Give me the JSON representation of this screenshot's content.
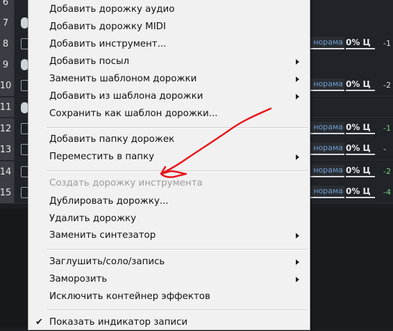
{
  "tracks": [
    {
      "num": "6",
      "pan": "",
      "vol": "",
      "meter": ""
    },
    {
      "num": "7",
      "pan": "",
      "vol": "",
      "meter": ""
    },
    {
      "num": "8",
      "pan": "норама",
      "vol": "0% Ц",
      "meter": "-1"
    },
    {
      "num": "9",
      "pan": "",
      "vol": "",
      "meter": ""
    },
    {
      "num": "10",
      "pan": "норама",
      "vol": "0% Ц",
      "meter": "-2"
    },
    {
      "num": "11",
      "pan": "",
      "vol": "",
      "meter": ""
    },
    {
      "num": "12",
      "pan": "норама",
      "vol": "0% Ц",
      "meter": "-1"
    },
    {
      "num": "13",
      "pan": "норама",
      "vol": "0% Ц",
      "meter": "-"
    },
    {
      "num": "14",
      "pan": "норама",
      "vol": "0% Ц",
      "meter": "-2"
    },
    {
      "num": "15",
      "pan": "норама",
      "vol": "0% Ц",
      "meter": "-4"
    }
  ],
  "menu": {
    "items": [
      {
        "label": "Добавить дорожку аудио",
        "submenu": false,
        "disabled": false
      },
      {
        "label": "Добавить дорожку MIDI",
        "submenu": false,
        "disabled": false
      },
      {
        "label": "Добавить инструмент...",
        "submenu": false,
        "disabled": false
      },
      {
        "label": "Добавить посыл",
        "submenu": true,
        "disabled": false
      },
      {
        "label": "Заменить шаблоном дорожки",
        "submenu": true,
        "disabled": false
      },
      {
        "label": "Добавить из шаблона дорожки",
        "submenu": true,
        "disabled": false
      },
      {
        "label": "Сохранить как шаблон дорожки...",
        "submenu": false,
        "disabled": false
      },
      {
        "label": "Добавить папку дорожек",
        "submenu": false,
        "disabled": false
      },
      {
        "label": "Переместить в папку",
        "submenu": true,
        "disabled": false
      },
      {
        "label": "Создать дорожку инструмента",
        "submenu": false,
        "disabled": true
      },
      {
        "label": "Дублировать дорожку...",
        "submenu": false,
        "disabled": false
      },
      {
        "label": "Удалить дорожку",
        "submenu": false,
        "disabled": false
      },
      {
        "label": "Заменить синтезатор",
        "submenu": true,
        "disabled": false
      },
      {
        "label": "Заглушить/соло/запись",
        "submenu": true,
        "disabled": false
      },
      {
        "label": "Заморозить",
        "submenu": true,
        "disabled": false
      },
      {
        "label": "Исключить контейнер эффектов",
        "submenu": false,
        "disabled": false
      },
      {
        "label": "Показать индикатор записи",
        "submenu": false,
        "disabled": false,
        "checked": true
      }
    ],
    "check_glyph": "✔"
  },
  "annotation": {
    "color": "#e8141c"
  }
}
